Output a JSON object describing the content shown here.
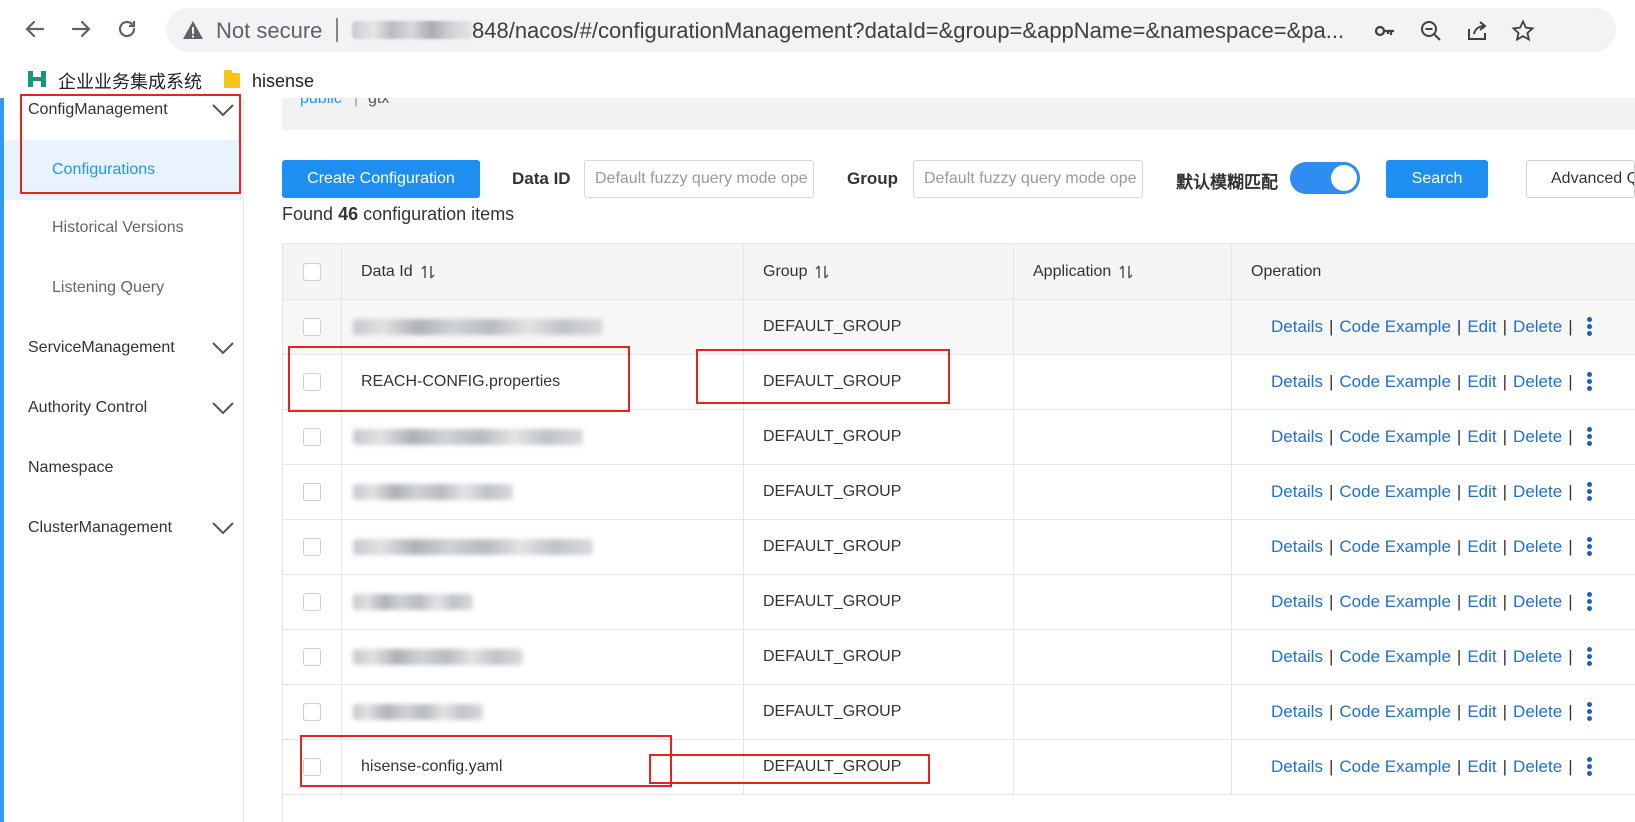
{
  "browser": {
    "not_secure": "Not secure",
    "url_visible": "848/nacos/#/configurationManagement?dataId=&group=&appName=&namespace=&pa..."
  },
  "bookmarks": [
    {
      "label": "企业业务集成系统",
      "icon": "h-logo-icon"
    },
    {
      "label": "hisense",
      "icon": "folder-icon"
    }
  ],
  "sidebar": {
    "config_management": "ConfigManagement",
    "sub_items": [
      "Configurations",
      "Historical Versions",
      "Listening Query"
    ],
    "service_management": "ServiceManagement",
    "authority_control": "Authority Control",
    "namespace": "Namespace",
    "cluster_management": "ClusterManagement"
  },
  "namespace_bar": {
    "public": "public",
    "sep": "|",
    "current": "gtx"
  },
  "filters": {
    "create_label": "Create Configuration",
    "data_id_label": "Data ID",
    "data_id_placeholder": "Default fuzzy query mode ope",
    "group_label": "Group",
    "group_placeholder": "Default fuzzy query mode ope",
    "fuzzy_label": "默认模糊匹配",
    "fuzzy_enabled": true,
    "search_label": "Search",
    "advanced_label": "Advanced Query"
  },
  "summary": {
    "prefix": "Found",
    "count": "46",
    "suffix": "configuration items"
  },
  "table": {
    "columns": {
      "data_id": "Data Id",
      "group": "Group",
      "application": "Application",
      "operation": "Operation"
    },
    "ops": {
      "details": "Details",
      "code_example": "Code Example",
      "edit": "Edit",
      "delete": "Delete",
      "sep": "|"
    },
    "rows": [
      {
        "data_id": "",
        "group": "DEFAULT_GROUP"
      },
      {
        "data_id": "REACH-CONFIG.properties",
        "group": "DEFAULT_GROUP"
      },
      {
        "data_id": "",
        "group": "DEFAULT_GROUP"
      },
      {
        "data_id": "",
        "group": "DEFAULT_GROUP"
      },
      {
        "data_id": "",
        "group": "DEFAULT_GROUP"
      },
      {
        "data_id": "",
        "group": "DEFAULT_GROUP"
      },
      {
        "data_id": "",
        "group": "DEFAULT_GROUP"
      },
      {
        "data_id": "",
        "group": "DEFAULT_GROUP"
      },
      {
        "data_id": "hisense-config.yaml",
        "group": "DEFAULT_GROUP"
      }
    ]
  },
  "colors": {
    "primary": "#1e8ff0",
    "link": "#1f6fd1",
    "highlight": "#e8231f",
    "active_bg": "#e8f3fd"
  }
}
